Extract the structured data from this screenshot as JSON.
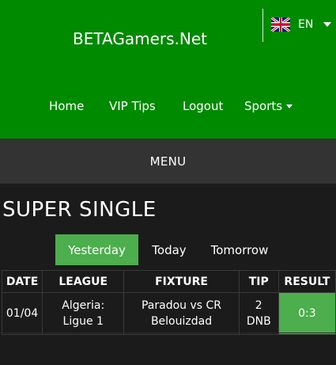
{
  "header": {
    "brand": "BETAGamers.Net",
    "language": {
      "code": "EN",
      "flag_icon": "uk-flag-icon"
    },
    "nav": {
      "home": "Home",
      "vip_tips": "VIP Tips",
      "logout": "Logout",
      "sports": "Sports"
    }
  },
  "menubar": {
    "label": "MENU"
  },
  "main": {
    "title": "SUPER SINGLE",
    "tabs": [
      {
        "label": "Yesterday",
        "active": true
      },
      {
        "label": "Today",
        "active": false
      },
      {
        "label": "Tomorrow",
        "active": false
      }
    ],
    "table": {
      "columns": [
        "DATE",
        "LEAGUE",
        "FIXTURE",
        "TIP",
        "RESULT"
      ],
      "rows": [
        {
          "date": "01/04",
          "league_line1": "Algeria:",
          "league_line2": "Ligue 1",
          "fixture_line1": "Paradou vs CR",
          "fixture_line2": "Belouizdad",
          "tip_line1": "2",
          "tip_line2": "DNB",
          "result": "0:3"
        }
      ]
    }
  },
  "colors": {
    "header_green": "#008a00",
    "accent_green": "#4cae4c",
    "menubar_bg": "#333333",
    "page_bg": "#1b1b1b"
  }
}
